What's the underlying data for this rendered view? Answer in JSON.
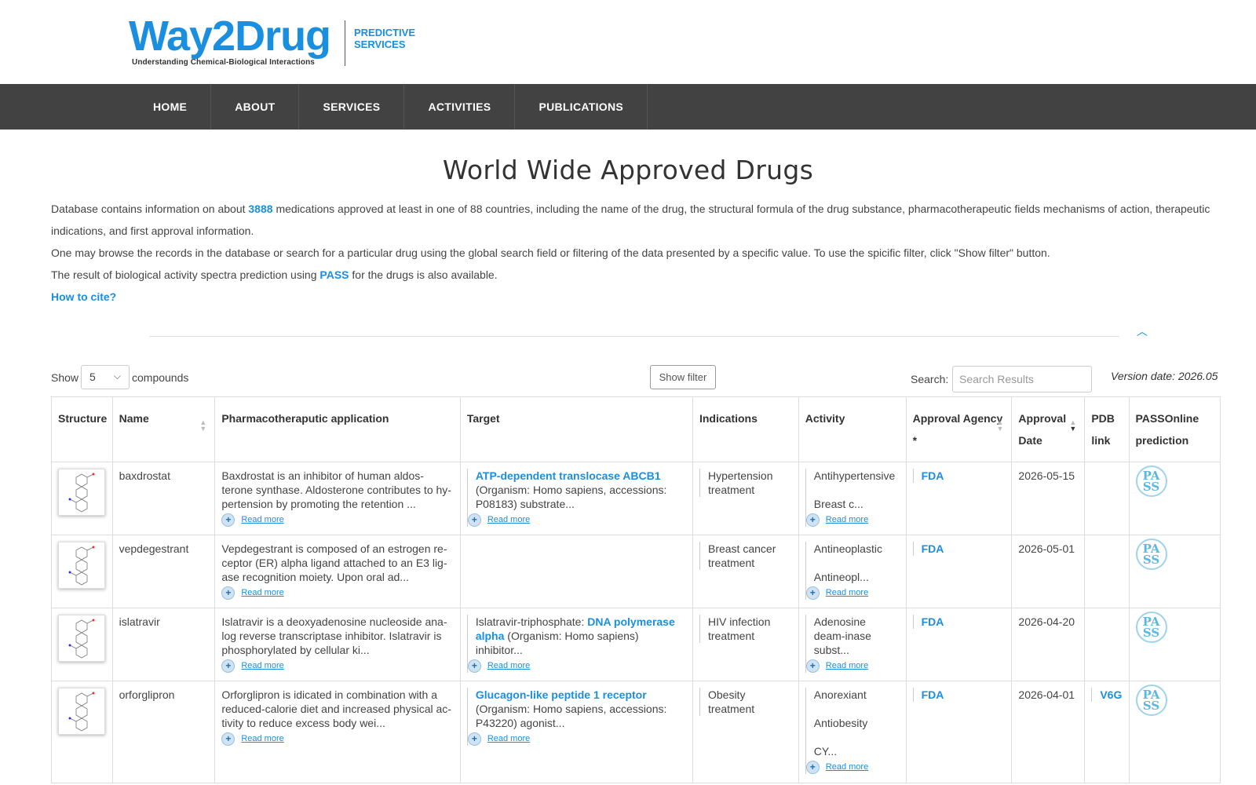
{
  "logo": {
    "main_way2": "Way2",
    "main_drug": "Drug",
    "side_line1": "PREDICTIVE",
    "side_line2": "SERVICES",
    "subtitle": "Understanding Chemical-Biological Interactions"
  },
  "nav": [
    "HOME",
    "ABOUT",
    "SERVICES",
    "ACTIVITIES",
    "PUBLICATIONS"
  ],
  "page_title": "World Wide Approved Drugs",
  "intro": {
    "p1_a": "Database contains information on about",
    "p1_count": "3888",
    "p1_b": "medications approved at least in one of 88 countries, including the name of the drug, the structural formula of the drug substance, pharmacotherapeutic fields mechanisms of action, therapeutic indications, and first approval information.",
    "p2": "One may browse the records in the database or search for a particular drug using the global search field or filtering of the data presented by a specific value. To use the spicific filter, click \"Show filter\" button.",
    "p3_a": "The result of biological activity spectra prediction using",
    "p3_link": "PASS",
    "p3_b": "for the drugs is also available.",
    "cite": "How to cite?"
  },
  "controls": {
    "show": "Show",
    "page_length": "5",
    "compounds": "compounds",
    "filter_button": "Show filter",
    "search_label": "Search:",
    "search_placeholder": "Search Results",
    "version": "Version date: 2026.05"
  },
  "table": {
    "headers": {
      "structure": "Structure",
      "name": "Name",
      "pharma": "Pharmacotheraputic application",
      "target": "Target",
      "indications": "Indications",
      "activity": "Activity",
      "agency": "Approval Agency *",
      "date": "Approval Date",
      "pdb": "PDB link",
      "pass": "PASSOnline prediction"
    },
    "read_more": "Read more",
    "pass_icon": "PA SS",
    "rows": [
      {
        "name": "baxdrostat",
        "pharma": "Baxdrostat is an inhibitor of human aldos-terone synthase. Aldosterone contributes to hy-pertension by promoting the retention ...",
        "target_prefix": "",
        "target_link": "ATP-dependent translocase ABCB1",
        "target_text": "(Organism: Homo sapiens, accessions: P08183) substrate...",
        "indications": "Hypertension treatment",
        "activities": [
          "Antihypertensive",
          "Breast c..."
        ],
        "agency": "FDA",
        "date": "2026-05-15",
        "pdb": ""
      },
      {
        "name": "vepdegestrant",
        "pharma": "Vepdegestrant is composed of an estrogen re-ceptor (ER) alpha ligand attached to an E3 lig-ase recognition moiety. Upon oral ad...",
        "target_prefix": "",
        "target_link": "",
        "target_text": "",
        "indications": "Breast cancer treatment",
        "activities": [
          "Antineoplastic",
          "Antineopl..."
        ],
        "agency": "FDA",
        "date": "2026-05-01",
        "pdb": ""
      },
      {
        "name": "islatravir",
        "pharma": "Islatravir is a deoxyadenosine nucleoside ana-log reverse transcriptase inhibitor. Islatravir is phosphorylated by cellular ki...",
        "target_prefix": "Islatravir-triphosphate: ",
        "target_link": "DNA polymerase alpha",
        "target_text": "(Organism: Homo sapiens) inhibitor...",
        "indications": "HIV infection treatment",
        "activities": [
          "Adenosine deam-inase subst..."
        ],
        "agency": "FDA",
        "date": "2026-04-20",
        "pdb": ""
      },
      {
        "name": "orforglipron",
        "pharma": "Orforglipron is idicated in combination with a reduced-calorie diet and increased physical ac-tivity to reduce excess body wei...",
        "target_prefix": "",
        "target_link": "Glucagon-like peptide 1 receptor",
        "target_text": "(Organism: Homo sapiens, accessions: P43220) agonist...",
        "indications": "Obesity treatment",
        "activities": [
          "Anorexiant",
          "Antiobesity",
          "CY..."
        ],
        "agency": "FDA",
        "date": "2026-04-01",
        "pdb": "V6G"
      }
    ]
  },
  "colors": {
    "accent": "#1a8fe0",
    "nav_bg": "#424242"
  }
}
